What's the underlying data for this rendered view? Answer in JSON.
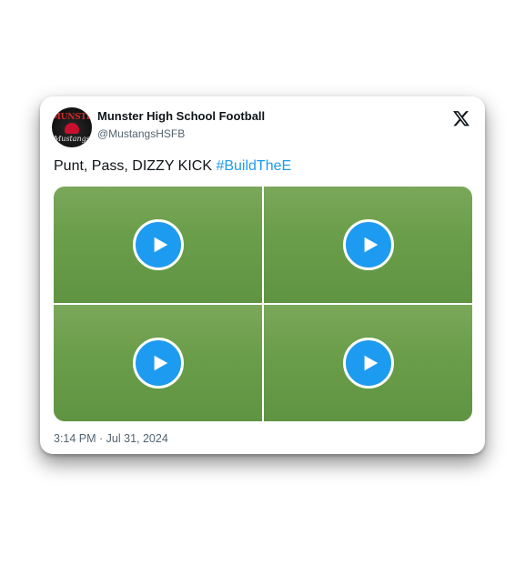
{
  "account": {
    "name": "Munster High School Football",
    "handle": "@MustangsHSFB",
    "avatar_text_top": "MUNSTER",
    "avatar_text_bottom": "Mustangs"
  },
  "post": {
    "text": "Punt, Pass, DIZZY KICK ",
    "hashtag": "#BuildTheE",
    "timestamp": "3:14 PM · Jul 31, 2024"
  },
  "media": {
    "count": 4,
    "icon": "play-icon"
  },
  "colors": {
    "accent": "#1d9bf0",
    "text": "#0f1419",
    "secondary": "#536471"
  }
}
